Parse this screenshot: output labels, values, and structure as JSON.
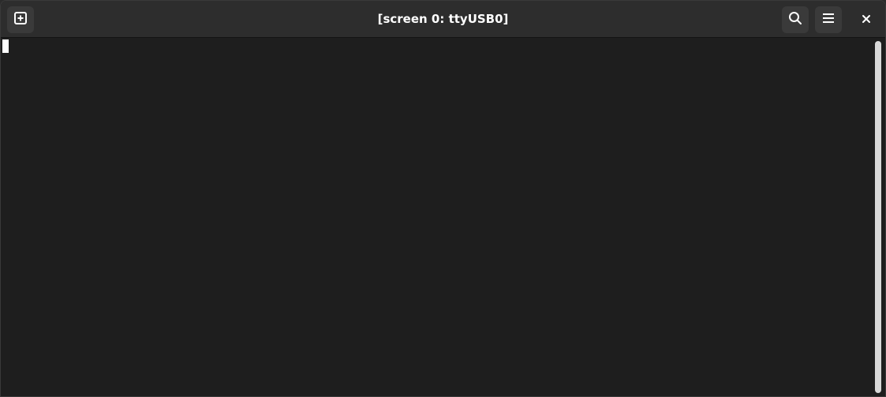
{
  "window": {
    "title": "[screen 0: ttyUSB0]"
  },
  "headerbar": {
    "new_tab_icon": "plus-square-icon",
    "search_icon": "search-icon",
    "menu_icon": "hamburger-menu-icon",
    "close_icon": "close-icon",
    "close_glyph": "✕"
  },
  "terminal": {
    "content": ""
  },
  "colors": {
    "background": "#1e1e1e",
    "headerbar": "#2d2d2d",
    "button": "#3a3a3a",
    "text": "#ffffff"
  }
}
